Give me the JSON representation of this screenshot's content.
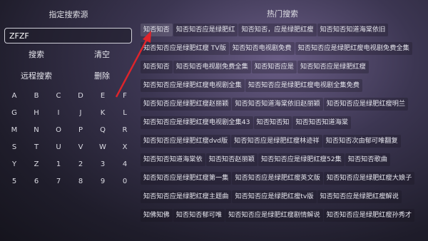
{
  "left": {
    "title": "指定搜索源",
    "search_value": "ZFZF",
    "buttons": {
      "search": "搜索",
      "clear": "清空",
      "remote": "远程搜索",
      "delete": "删除"
    },
    "keys": [
      "A",
      "B",
      "C",
      "D",
      "E",
      "F",
      "G",
      "H",
      "I",
      "J",
      "K",
      "L",
      "M",
      "N",
      "O",
      "P",
      "Q",
      "R",
      "S",
      "T",
      "U",
      "V",
      "W",
      "X",
      "Y",
      "Z",
      "1",
      "2",
      "3",
      "4",
      "5",
      "6",
      "7",
      "8",
      "9",
      "0"
    ]
  },
  "right": {
    "title": "热门搜索",
    "tags": [
      "知否知否",
      "知否知否应是绿肥红",
      "知否知否，应是绿肥红瘦",
      "知否知否知道海棠依旧",
      "知否知否应是绿肥红瘦 TV版",
      "知否知否电视剧免费",
      "知否知否应是绿肥红瘦电视剧免费全集",
      "知否知否",
      "知否知否电视剧免费全集",
      "知否知否应是",
      "知否知否应是绿肥红瘦",
      "知否知否应是绿肥红瘦电视剧全集",
      "知否知否应是绿肥红瘦电视剧全集免费",
      "知否知否应是绿肥红瘦赵丽颖",
      "知否知否知道海棠依旧赵丽颖",
      "知否知否应是绿肥红瘦明兰",
      "知否知否应是绿肥红瘦电视剧全集43",
      "知否知否知",
      "知否知否知道海棠",
      "知否知否应是绿肥红瘦dvd版",
      "知否知否应是绿肥红瘦林迹祥",
      "知否知否次由郁可唯翻复",
      "知否知否知道海棠依",
      "知否知否赵丽颖",
      "知否知否应是绿肥红瘦52集",
      "知否知否歌曲",
      "知否知否应是绿肥红瘦第一集",
      "知否知否应是绿肥红瘦英文版",
      "知否知否应是绿肥红瘦大娘子",
      "知否知否应是绿肥红瘦主题曲",
      "知否知否应是绿肥红瘦tv版",
      "知否知否应是绿肥红瘦解说",
      "知佛知佛",
      "知否知否郁可唯",
      "知否知否应是绿肥红瘦剧情解说",
      "知否知否应是绿肥红瘦孙秀才"
    ]
  }
}
